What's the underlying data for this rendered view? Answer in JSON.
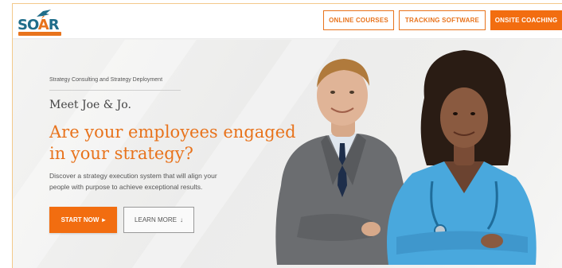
{
  "brand": {
    "logo_text_1": "SO",
    "logo_text_2": "A",
    "logo_text_3": "R",
    "accent": "#f26d10",
    "blue": "#1f6d8a"
  },
  "nav": {
    "items": [
      {
        "label": "ONLINE COURSES"
      },
      {
        "label": "TRACKING SOFTWARE"
      },
      {
        "label": "ONSITE COACHING"
      }
    ]
  },
  "hero": {
    "eyebrow": "Strategy Consulting and Strategy Deployment",
    "meet": "Meet Joe & Jo.",
    "headline_line1": "Are your employees engaged",
    "headline_line2": "in your strategy?",
    "desc_line1": "Discover a strategy execution system that will align your",
    "desc_line2": "people with purpose to achieve exceptional results.",
    "cta_primary": "START NOW",
    "cta_secondary": "LEARN MORE",
    "cta_primary_icon": "chevron-right-icon",
    "cta_secondary_icon": "arrow-down-icon"
  }
}
